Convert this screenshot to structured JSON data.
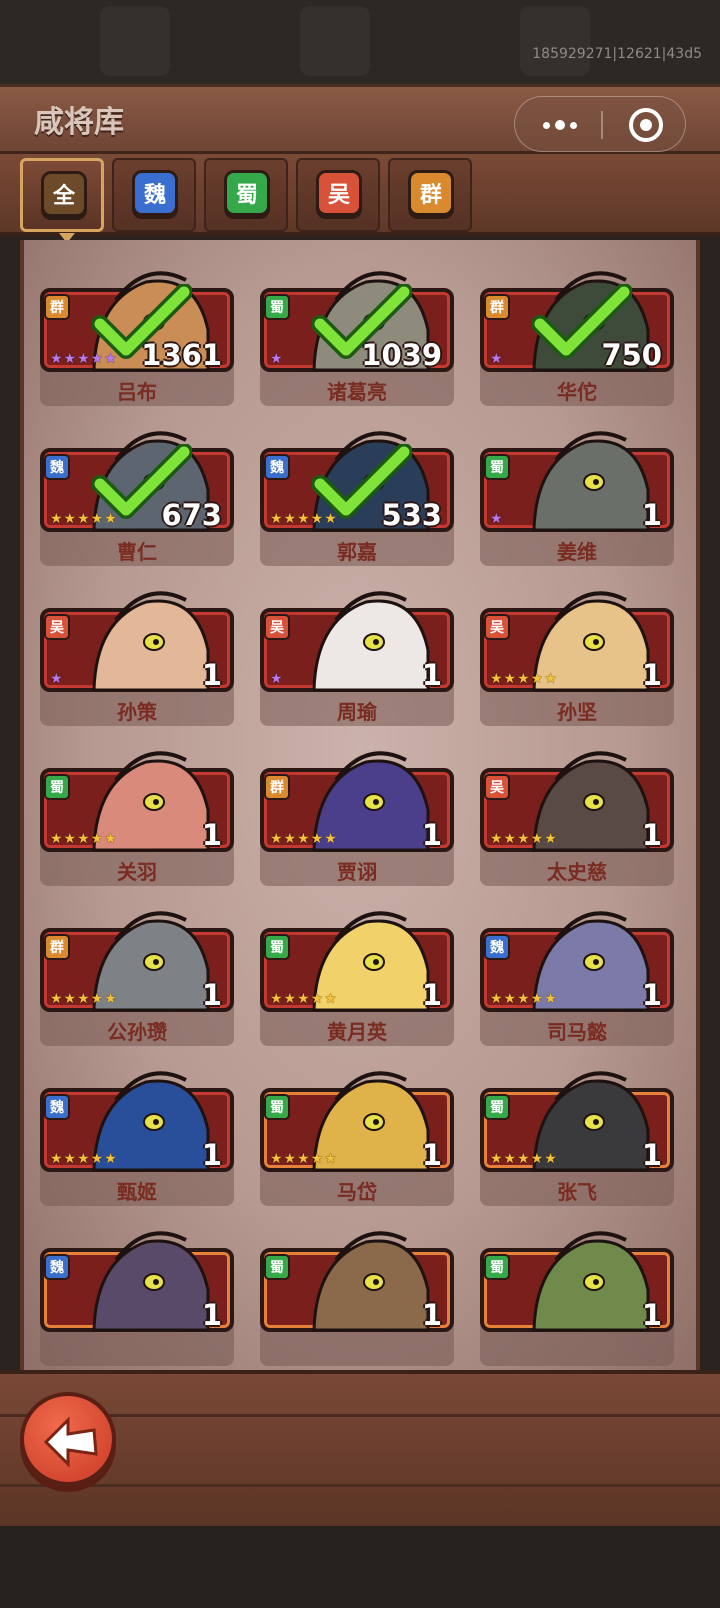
{
  "build_id": "185929271|12621|43d5",
  "title": "咸将库",
  "colors": {
    "wei": "#3a6fd0",
    "shu": "#35a84a",
    "wu": "#d8523a",
    "qun": "#d98a2e",
    "all": "#6d4a2a"
  },
  "tabs": [
    {
      "label": "全",
      "active": true,
      "color": "#6d4a2a"
    },
    {
      "label": "魏",
      "active": false,
      "color": "#3a6fd0"
    },
    {
      "label": "蜀",
      "active": false,
      "color": "#35a84a"
    },
    {
      "label": "吴",
      "active": false,
      "color": "#d8523a"
    },
    {
      "label": "群",
      "active": false,
      "color": "#d98a2e"
    }
  ],
  "heroes": [
    {
      "name": "吕布",
      "faction": "群",
      "count": "1361",
      "stars": 5,
      "star_color": "purple",
      "owned": true,
      "skin": "#c98d55",
      "frame": "red"
    },
    {
      "name": "诸葛亮",
      "faction": "蜀",
      "count": "1039",
      "stars": 1,
      "star_color": "purple",
      "owned": true,
      "skin": "#8e8a7c",
      "frame": "red"
    },
    {
      "name": "华佗",
      "faction": "群",
      "count": "750",
      "stars": 1,
      "star_color": "purple",
      "owned": true,
      "skin": "#3e4a3a",
      "frame": "red"
    },
    {
      "name": "曹仁",
      "faction": "魏",
      "count": "673",
      "stars": 5,
      "star_color": "gold",
      "owned": true,
      "skin": "#5d6570",
      "frame": "red"
    },
    {
      "name": "郭嘉",
      "faction": "魏",
      "count": "533",
      "stars": 5,
      "star_color": "gold",
      "owned": true,
      "skin": "#2a3e5a",
      "frame": "red"
    },
    {
      "name": "姜维",
      "faction": "蜀",
      "count": "1",
      "stars": 1,
      "star_color": "purple",
      "owned": false,
      "skin": "#6b6f6a",
      "frame": "red"
    },
    {
      "name": "孙策",
      "faction": "吴",
      "count": "1",
      "stars": 1,
      "star_color": "purple",
      "owned": false,
      "skin": "#e2b898",
      "frame": "red"
    },
    {
      "name": "周瑜",
      "faction": "吴",
      "count": "1",
      "stars": 1,
      "star_color": "purple",
      "owned": false,
      "skin": "#ede8e6",
      "frame": "red"
    },
    {
      "name": "孙坚",
      "faction": "吴",
      "count": "1",
      "stars": 5,
      "star_color": "gold",
      "owned": false,
      "skin": "#e7c38a",
      "frame": "red"
    },
    {
      "name": "关羽",
      "faction": "蜀",
      "count": "1",
      "stars": 5,
      "star_color": "gold",
      "owned": false,
      "skin": "#d98a7a",
      "frame": "red"
    },
    {
      "name": "贾诩",
      "faction": "群",
      "count": "1",
      "stars": 5,
      "star_color": "gold",
      "owned": false,
      "skin": "#4b3f8c",
      "frame": "red"
    },
    {
      "name": "太史慈",
      "faction": "吴",
      "count": "1",
      "stars": 5,
      "star_color": "gold",
      "owned": false,
      "skin": "#5a4a46",
      "frame": "red"
    },
    {
      "name": "公孙瓒",
      "faction": "群",
      "count": "1",
      "stars": 5,
      "star_color": "gold",
      "owned": false,
      "skin": "#7e8286",
      "frame": "red"
    },
    {
      "name": "黄月英",
      "faction": "蜀",
      "count": "1",
      "stars": 5,
      "star_color": "gold",
      "owned": false,
      "skin": "#f1d26a",
      "frame": "red"
    },
    {
      "name": "司马懿",
      "faction": "魏",
      "count": "1",
      "stars": 5,
      "star_color": "gold",
      "owned": false,
      "skin": "#7b7aa8",
      "frame": "red"
    },
    {
      "name": "甄姬",
      "faction": "魏",
      "count": "1",
      "stars": 5,
      "star_color": "gold",
      "owned": false,
      "skin": "#2a4f9a",
      "frame": "red"
    },
    {
      "name": "马岱",
      "faction": "蜀",
      "count": "1",
      "stars": 5,
      "star_color": "gold",
      "owned": false,
      "skin": "#e0b24a",
      "frame": "gold"
    },
    {
      "name": "张飞",
      "faction": "蜀",
      "count": "1",
      "stars": 5,
      "star_color": "gold",
      "owned": false,
      "skin": "#3a3a3c",
      "frame": "gold"
    },
    {
      "name": "",
      "faction": "魏",
      "count": "1",
      "stars": 0,
      "star_color": "gold",
      "owned": false,
      "skin": "#5a4a6a",
      "frame": "gold"
    },
    {
      "name": "",
      "faction": "蜀",
      "count": "1",
      "stars": 0,
      "star_color": "gold",
      "owned": false,
      "skin": "#8a6a4a",
      "frame": "gold"
    },
    {
      "name": "",
      "faction": "蜀",
      "count": "1",
      "stars": 0,
      "star_color": "gold",
      "owned": false,
      "skin": "#6f8a4a",
      "frame": "gold"
    }
  ]
}
